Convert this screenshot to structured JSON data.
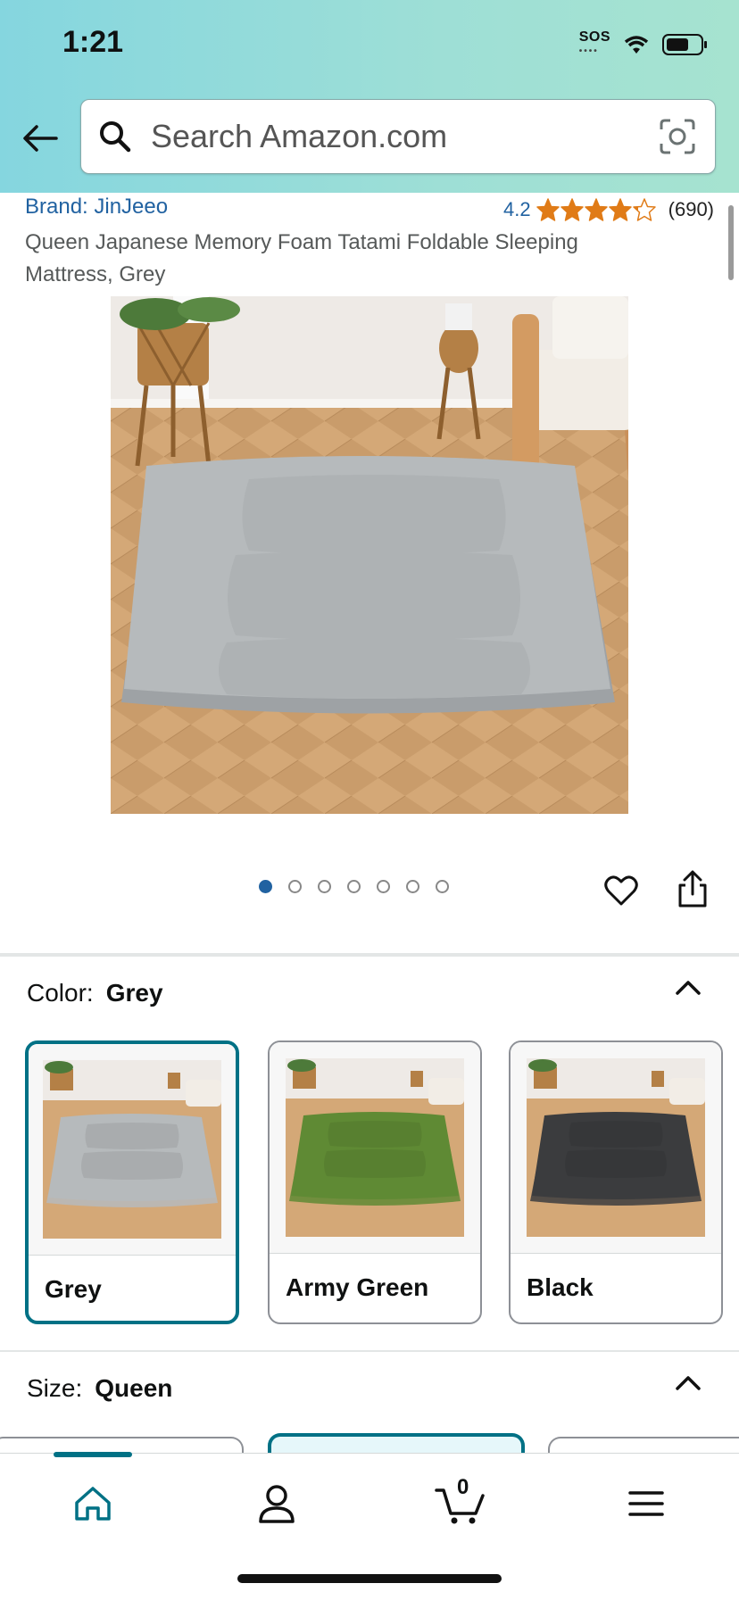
{
  "status_bar": {
    "time": "1:21",
    "sos": "SOS"
  },
  "search": {
    "placeholder": "Search Amazon.com"
  },
  "product": {
    "brand": "Brand: JinJeeo",
    "rating_value": "4.2",
    "rating_stars": 4.2,
    "rating_count": "(690)",
    "title": "Queen Japanese Memory Foam Tatami Foldable Sleeping Mattress, Grey",
    "image_count": 7,
    "active_image_index": 0
  },
  "color_section": {
    "label": "Color:",
    "selected": "Grey",
    "options": [
      {
        "name": "Grey",
        "color": "#b6babc"
      },
      {
        "name": "Army Green",
        "color": "#5f8a34"
      },
      {
        "name": "Black",
        "color": "#3b3c3e"
      }
    ]
  },
  "size_section": {
    "label": "Size:",
    "selected": "Queen"
  },
  "bottom_nav": {
    "cart_count": "0"
  },
  "colors": {
    "accent": "#007185",
    "link": "#2162a1",
    "star": "#e07b17"
  }
}
